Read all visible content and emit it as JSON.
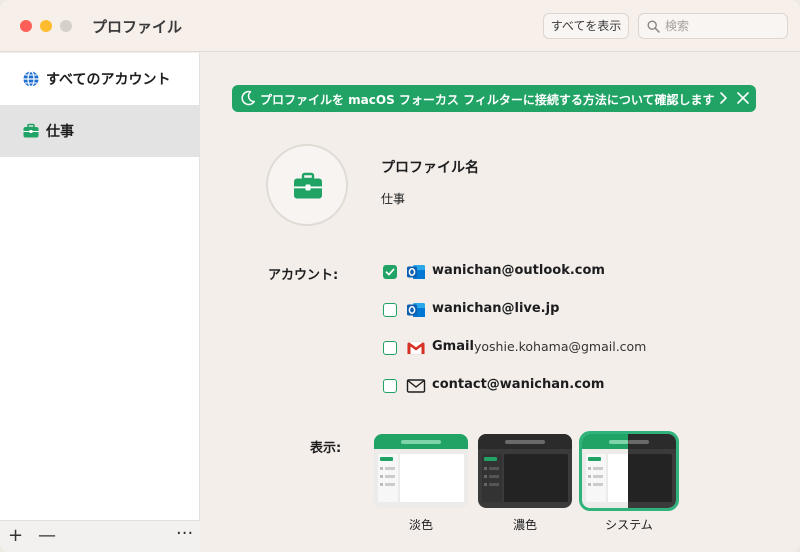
{
  "window": {
    "title": "プロファイル"
  },
  "toolbar": {
    "show_all_label": "すべてを表示",
    "search_placeholder": "検索"
  },
  "sidebar": {
    "items": [
      {
        "label": "すべてのアカウント",
        "icon": "globe-icon"
      },
      {
        "label": "仕事",
        "icon": "briefcase-icon",
        "selected": true
      }
    ],
    "footer": {
      "add": "+",
      "remove": "—",
      "more": "···"
    }
  },
  "banner": {
    "text": "プロファイルを macOS フォーカス フィルターに接続する方法について確認します",
    "color": "#21a366"
  },
  "profile": {
    "name_label": "プロファイル名",
    "name_value": "仕事",
    "icon": "briefcase-icon"
  },
  "accounts": {
    "heading": "アカウント:",
    "items": [
      {
        "name": "wanichan@outlook.com",
        "detail": "",
        "icon": "outlook-icon",
        "checked": true
      },
      {
        "name": "wanichan@live.jp",
        "detail": "",
        "icon": "outlook-icon",
        "checked": false
      },
      {
        "name": "Gmail",
        "detail": "yoshie.kohama@gmail.com",
        "icon": "gmail-icon",
        "checked": false
      },
      {
        "name": "contact@wanichan.com",
        "detail": "",
        "icon": "mail-icon",
        "checked": false
      }
    ]
  },
  "appearance": {
    "heading": "表示:",
    "options": [
      {
        "label": "淡色",
        "selected": false
      },
      {
        "label": "濃色",
        "selected": false
      },
      {
        "label": "システム",
        "selected": true
      }
    ]
  },
  "colors": {
    "accent": "#21a366",
    "background": "#f3eeea"
  }
}
